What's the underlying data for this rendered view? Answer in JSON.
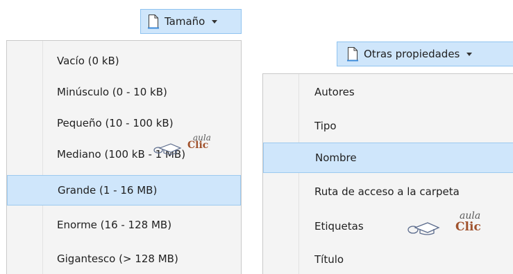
{
  "size_menu": {
    "button_label": "Tamaño",
    "button_icon": "document-icon",
    "items": [
      {
        "label": "Vacío (0 kB)",
        "selected": false
      },
      {
        "label": "Minúsculo (0 - 10 kB)",
        "selected": false
      },
      {
        "label": "Pequeño (10 - 100 kB)",
        "selected": false
      },
      {
        "label": "Mediano (100 kB - 1 MB)",
        "selected": false
      },
      {
        "label": "Grande (1 - 16 MB)",
        "selected": true
      },
      {
        "label": "Enorme (16 - 128 MB)",
        "selected": false
      },
      {
        "label": "Gigantesco (> 128 MB)",
        "selected": false
      }
    ]
  },
  "props_menu": {
    "button_label": "Otras propiedades",
    "button_icon": "document-icon",
    "items": [
      {
        "label": "Autores",
        "selected": false
      },
      {
        "label": "Tipo",
        "selected": false
      },
      {
        "label": "Nombre",
        "selected": true
      },
      {
        "label": "Ruta de acceso a la carpeta",
        "selected": false
      },
      {
        "label": "Etiquetas",
        "selected": false
      },
      {
        "label": "Título",
        "selected": false
      }
    ]
  },
  "watermark": {
    "aula": "aula",
    "clic": "Clic",
    "clic_color": "#a0522d"
  },
  "colors": {
    "selection_bg": "#cfe6fb",
    "selection_border": "#9cc9ef",
    "menu_bg": "#f4f4f4"
  }
}
